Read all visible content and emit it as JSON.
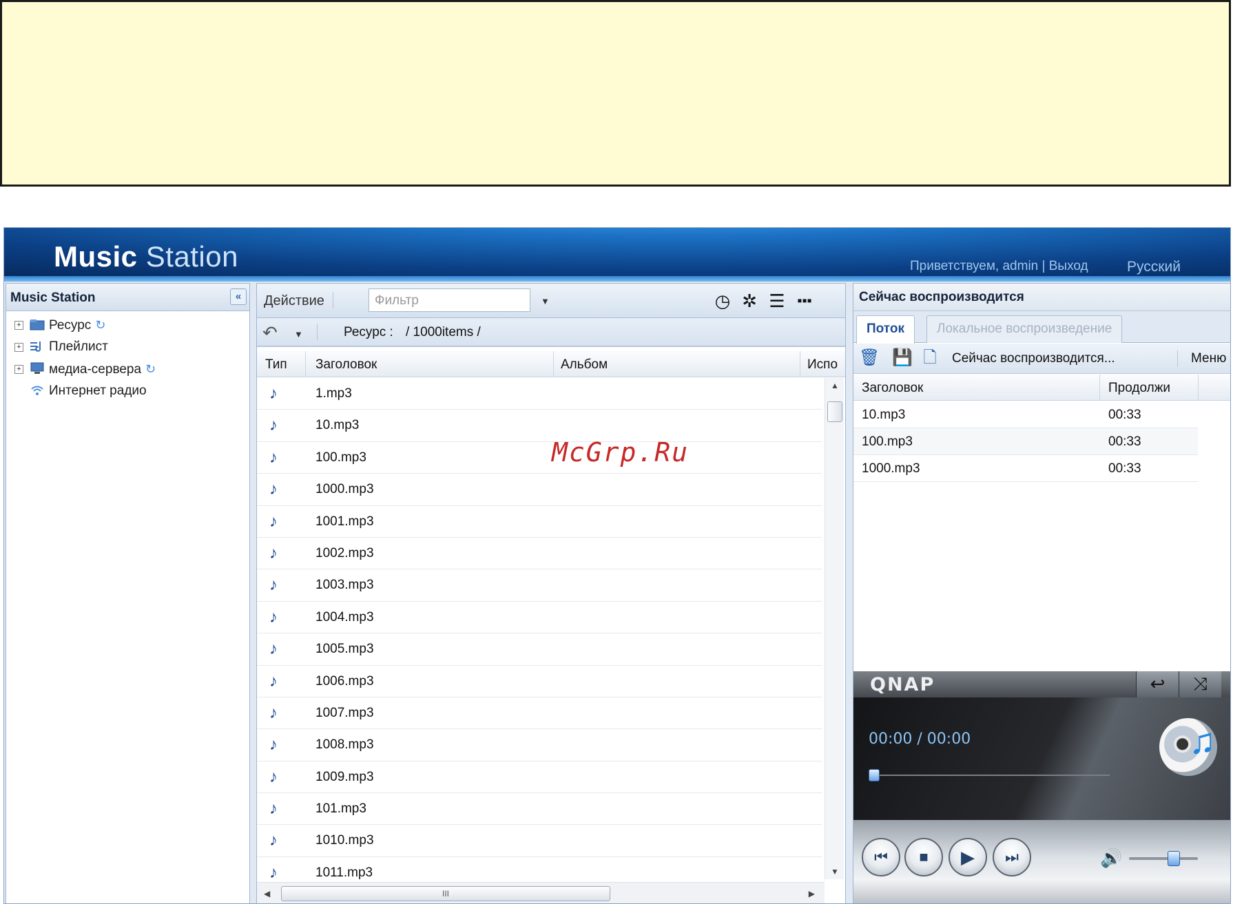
{
  "app": {
    "logo_bold": "Music",
    "logo_light": "Station",
    "greeting": "Приветствуем, admin | Выход",
    "language": "Русский"
  },
  "left_panel": {
    "title": "Music Station",
    "items": [
      {
        "label": "Ресурс",
        "icon": "folder-icon"
      },
      {
        "label": "Плейлист",
        "icon": "playlist-icon"
      },
      {
        "label": "медиа-сервера",
        "icon": "monitor-icon"
      },
      {
        "label": "Интернет радио",
        "icon": "wifi-icon"
      }
    ]
  },
  "middle_panel": {
    "action_label": "Действие",
    "filter_placeholder": "Фильтр",
    "breadcrumb_label": "Ресурс :",
    "breadcrumb_path": "/ 1000items /",
    "columns": [
      "Тип",
      "Заголовок",
      "Альбом",
      "Испо"
    ],
    "files": [
      "1.mp3",
      "10.mp3",
      "100.mp3",
      "1000.mp3",
      "1001.mp3",
      "1002.mp3",
      "1003.mp3",
      "1004.mp3",
      "1005.mp3",
      "1006.mp3",
      "1007.mp3",
      "1008.mp3",
      "1009.mp3",
      "101.mp3",
      "1010.mp3",
      "1011.mp3"
    ],
    "hscroll_grip": "III"
  },
  "right_panel": {
    "title": "Сейчас воспроизводится",
    "tabs": [
      "Поток",
      "Локальное воспроизведение"
    ],
    "toolbar_label": "Сейчас воспроизводится...",
    "menu_label": "Меню",
    "columns": [
      "Заголовок",
      "Продолжи"
    ],
    "rows": [
      {
        "title": "10.mp3",
        "duration": "00:33"
      },
      {
        "title": "100.mp3",
        "duration": "00:33"
      },
      {
        "title": "1000.mp3",
        "duration": "00:33"
      }
    ]
  },
  "player": {
    "brand": "QNAP",
    "time": "00:00 / 00:00",
    "progress": 0,
    "volume": 0.65
  },
  "watermark": "McGrp.Ru"
}
